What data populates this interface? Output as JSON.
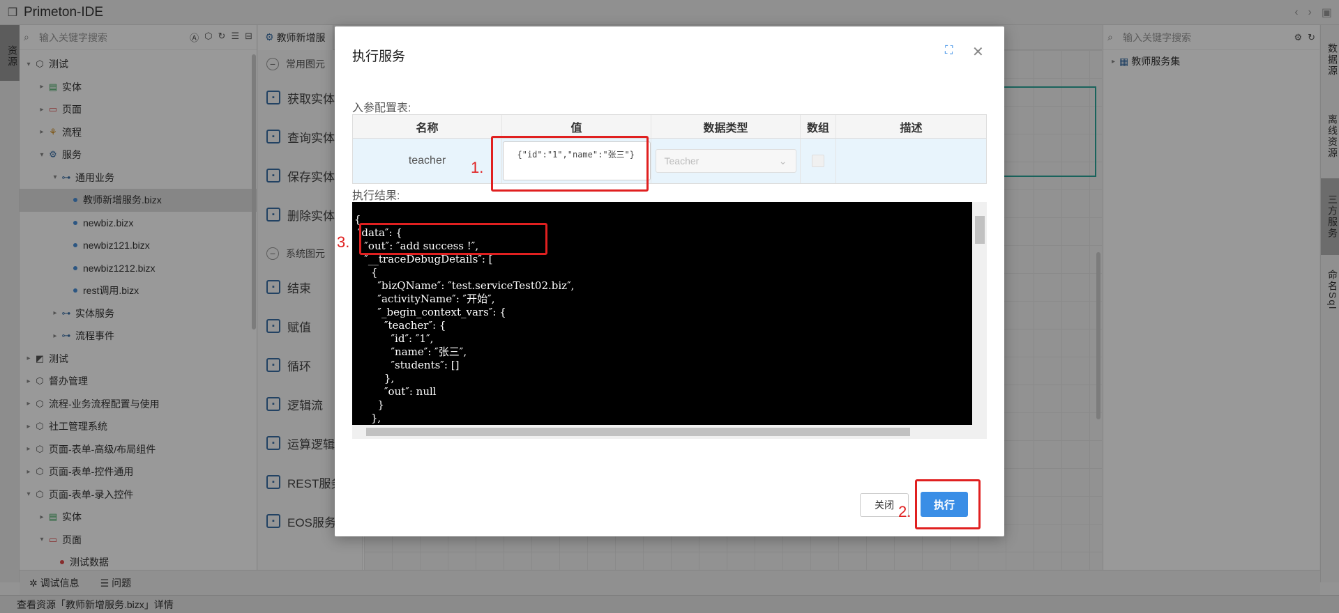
{
  "app": {
    "title": "Primeton-IDE"
  },
  "left_rail": {
    "tab": "资源"
  },
  "left_panel": {
    "search_placeholder": "输入关键字搜索",
    "tree": [
      {
        "label": "测试",
        "indent": 0,
        "arrow": "▾",
        "icon": "package-icon"
      },
      {
        "label": "实体",
        "indent": 1,
        "arrow": "▸",
        "icon": "entity-icon"
      },
      {
        "label": "页面",
        "indent": 1,
        "arrow": "▸",
        "icon": "page-icon"
      },
      {
        "label": "流程",
        "indent": 1,
        "arrow": "▸",
        "icon": "flow-icon"
      },
      {
        "label": "服务",
        "indent": 1,
        "arrow": "▾",
        "icon": "service-icon"
      },
      {
        "label": "通用业务",
        "indent": 2,
        "arrow": "▾",
        "icon": "biz-icon"
      },
      {
        "label": "教师新增服务.bizx",
        "indent": 3,
        "arrow": "",
        "icon": "file-dot",
        "selected": true
      },
      {
        "label": "newbiz.bizx",
        "indent": 3,
        "arrow": "",
        "icon": "file-dot"
      },
      {
        "label": "newbiz121.bizx",
        "indent": 3,
        "arrow": "",
        "icon": "file-dot"
      },
      {
        "label": "newbiz1212.bizx",
        "indent": 3,
        "arrow": "",
        "icon": "file-dot"
      },
      {
        "label": "rest调用.bizx",
        "indent": 3,
        "arrow": "",
        "icon": "file-dot"
      },
      {
        "label": "实体服务",
        "indent": 2,
        "arrow": "▸",
        "icon": "biz-icon"
      },
      {
        "label": "流程事件",
        "indent": 2,
        "arrow": "▸",
        "icon": "biz-icon"
      },
      {
        "label": "测试",
        "indent": 0,
        "arrow": "▸",
        "icon": "chart-icon"
      },
      {
        "label": "督办管理",
        "indent": 0,
        "arrow": "▸",
        "icon": "package-icon"
      },
      {
        "label": "流程-业务流程配置与使用",
        "indent": 0,
        "arrow": "▸",
        "icon": "package-icon"
      },
      {
        "label": "社工管理系统",
        "indent": 0,
        "arrow": "▸",
        "icon": "package-icon"
      },
      {
        "label": "页面-表单-高级/布局组件",
        "indent": 0,
        "arrow": "▸",
        "icon": "package-icon"
      },
      {
        "label": "页面-表单-控件通用",
        "indent": 0,
        "arrow": "▸",
        "icon": "package-icon"
      },
      {
        "label": "页面-表单-录入控件",
        "indent": 0,
        "arrow": "▾",
        "icon": "package-icon"
      },
      {
        "label": "实体",
        "indent": 1,
        "arrow": "▸",
        "icon": "entity-icon"
      },
      {
        "label": "页面",
        "indent": 1,
        "arrow": "▾",
        "icon": "page-icon"
      },
      {
        "label": "测试数据",
        "indent": 2,
        "arrow": "",
        "icon": "file-dot-red"
      }
    ]
  },
  "editor": {
    "tab_label": "教师新增服",
    "palette": {
      "head1": "常用图元",
      "items1": [
        "获取实体",
        "查询实体",
        "保存实体",
        "删除实体"
      ],
      "head2": "系统图元",
      "items2": [
        "结束",
        "赋值",
        "循环",
        "逻辑流",
        "运算逻辑",
        "REST服务",
        "EOS服务"
      ]
    }
  },
  "right_panel": {
    "search_placeholder": "输入关键字搜索",
    "tree_item": "教师服务集"
  },
  "right_rail": [
    "数据源",
    "离线资源",
    "三方服务",
    "命名Sql"
  ],
  "bottom_tabs": {
    "debug": "调试信息",
    "problems": "问题"
  },
  "statusbar": {
    "text": "查看资源「教师新增服务.bizx」详情"
  },
  "dialog": {
    "title": "执行服务",
    "input_label": "入参配置表:",
    "columns": [
      "名称",
      "值",
      "数据类型",
      "数组",
      "描述"
    ],
    "row": {
      "name": "teacher",
      "value": "{\"id\":\"1\",\"name\":\"张三\"}",
      "type": "Teacher"
    },
    "result_label": "执行结果:",
    "result_text": "{\n ″data″: {\n   ″out″: ″add success !″,\n   ″__traceDebugDetails″: [\n     {\n       ″bizQName″: ″test.serviceTest02.biz″,\n       ″activityName″: ″开始″,\n       ″_begin_context_vars″: {\n         ″teacher″: {\n           ″id″: ″1″,\n           ″name″: ″张三″,\n           ″students″: []\n         },\n         ″out″: null\n       }\n     },",
    "close_label": "关闭",
    "exec_label": "执行",
    "annotations": {
      "a1": "1.",
      "a2": "2.",
      "a3": "3."
    }
  },
  "colors": {
    "accent": "#3a8ee6",
    "annotation": "#e02020",
    "console_bg": "#000000"
  }
}
